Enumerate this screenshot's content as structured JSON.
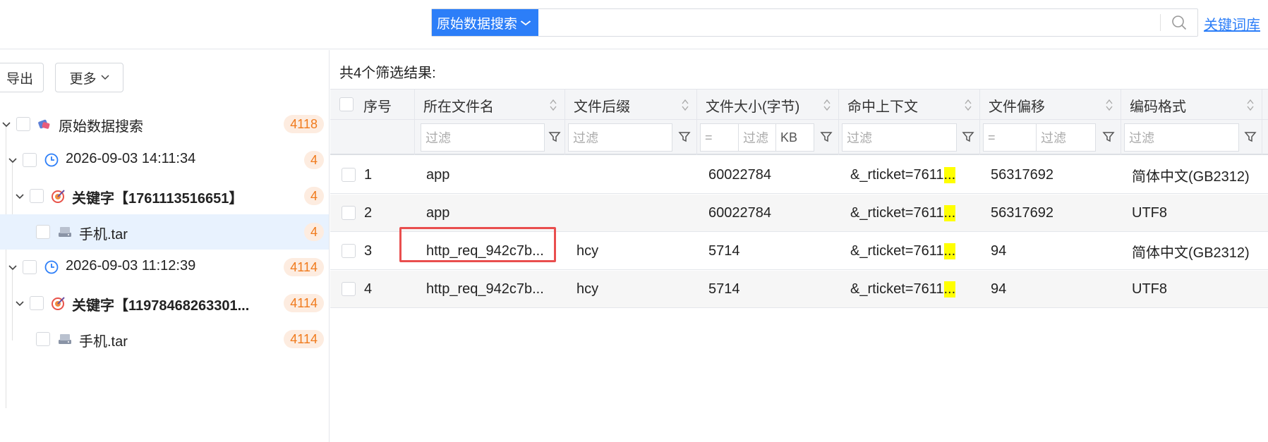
{
  "search": {
    "type_label": "原始数据搜索",
    "value": "",
    "keyword_link": "关键词库"
  },
  "toolbar": {
    "export_label": "导出",
    "more_label": "更多"
  },
  "tree": {
    "root": {
      "label": "原始数据搜索",
      "count": "4118"
    },
    "items": [
      {
        "label": "2026-09-03 14:11:34",
        "count": "4"
      },
      {
        "label": "关键字【1761113516651】",
        "count": "4"
      },
      {
        "label": "手机.tar",
        "count": "4"
      },
      {
        "label": "2026-09-03 11:12:39",
        "count": "4114"
      },
      {
        "label": "关键字【11978468263301...",
        "count": "4114"
      },
      {
        "label": "手机.tar",
        "count": "4114"
      }
    ]
  },
  "results": {
    "summary": "共4个筛选结果:",
    "columns": [
      "序号",
      "所在文件名",
      "文件后缀",
      "文件大小(字节)",
      "命中上下文",
      "文件偏移",
      "编码格式"
    ],
    "filter_placeholder": "过滤",
    "eq_symbol": "=",
    "unit_kb": "KB",
    "rows": [
      {
        "no": "1",
        "filename": "app",
        "suffix": "",
        "size": "60022784",
        "context": "&_rticket=7611",
        "ctx_hl": "...",
        "offset": "56317692",
        "encoding": "简体中文(GB2312)"
      },
      {
        "no": "2",
        "filename": "app",
        "suffix": "",
        "size": "60022784",
        "context": "&_rticket=7611",
        "ctx_hl": "...",
        "offset": "56317692",
        "encoding": "UTF8"
      },
      {
        "no": "3",
        "filename": "http_req_942c7b...",
        "suffix": "hcy",
        "size": "5714",
        "context": "&_rticket=7611",
        "ctx_hl": "...",
        "offset": "94",
        "encoding": "简体中文(GB2312)"
      },
      {
        "no": "4",
        "filename": "http_req_942c7b...",
        "suffix": "hcy",
        "size": "5714",
        "context": "&_rticket=7611",
        "ctx_hl": "...",
        "offset": "94",
        "encoding": "UTF8"
      }
    ]
  },
  "colors": {
    "accent": "#2c7ef8",
    "badge_text": "#f07a1c",
    "badge_bg": "#fdece0",
    "highlight": "#ffff00",
    "annotation_box": "#e94e4e"
  },
  "icons": [
    "chevron-down-icon",
    "search-icon",
    "database-icon",
    "clock-icon",
    "target-icon",
    "drive-icon",
    "sort-icon",
    "filter-icon"
  ]
}
